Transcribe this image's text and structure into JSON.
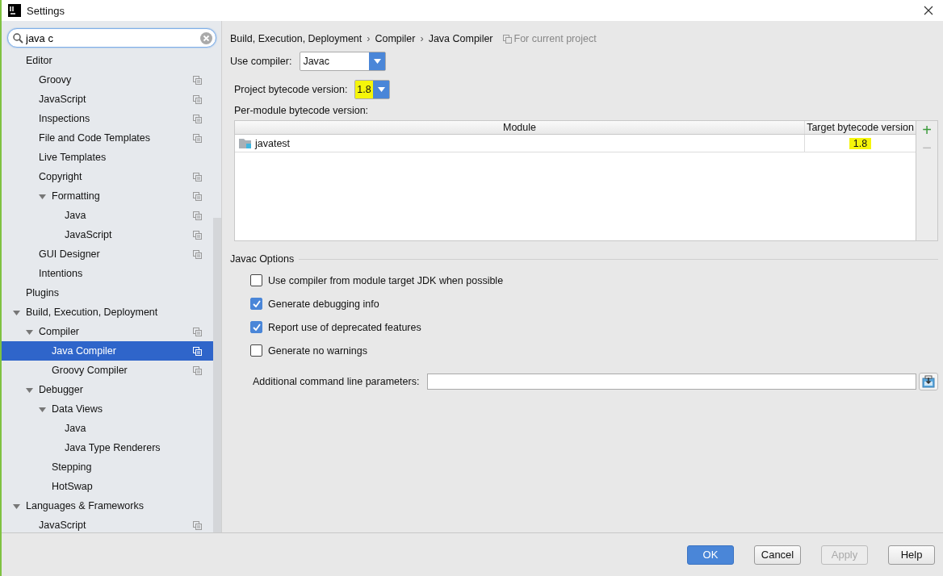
{
  "window": {
    "title": "Settings"
  },
  "search": {
    "value": "java c"
  },
  "tree": [
    {
      "label": "Editor",
      "project": false,
      "selected": false,
      "children": [
        {
          "label": "Groovy",
          "project": true,
          "selected": false
        },
        {
          "label": "JavaScript",
          "project": true,
          "selected": false
        },
        {
          "label": "Inspections",
          "project": true,
          "selected": false
        },
        {
          "label": "File and Code Templates",
          "project": true,
          "selected": false
        },
        {
          "label": "Live Templates",
          "project": false,
          "selected": false
        },
        {
          "label": "Copyright",
          "project": true,
          "selected": false,
          "children": [
            {
              "label": "Formatting",
              "project": true,
              "selected": false,
              "expanded": true,
              "children": [
                {
                  "label": "Java",
                  "project": true,
                  "selected": false
                },
                {
                  "label": "JavaScript",
                  "project": true,
                  "selected": false
                }
              ]
            }
          ]
        },
        {
          "label": "GUI Designer",
          "project": true,
          "selected": false
        },
        {
          "label": "Intentions",
          "project": false,
          "selected": false
        }
      ]
    },
    {
      "label": "Plugins",
      "project": false,
      "selected": false
    },
    {
      "label": "Build, Execution, Deployment",
      "project": false,
      "selected": false,
      "expanded": true,
      "children": [
        {
          "label": "Compiler",
          "project": true,
          "selected": false,
          "expanded": true,
          "children": [
            {
              "label": "Java Compiler",
              "project": true,
              "selected": true
            },
            {
              "label": "Groovy Compiler",
              "project": true,
              "selected": false
            }
          ]
        },
        {
          "label": "Debugger",
          "project": false,
          "selected": false,
          "expanded": true,
          "children": [
            {
              "label": "Data Views",
              "project": false,
              "selected": false,
              "expanded": true,
              "children": [
                {
                  "label": "Java",
                  "project": false,
                  "selected": false
                },
                {
                  "label": "Java Type Renderers",
                  "project": false,
                  "selected": false
                }
              ]
            },
            {
              "label": "Stepping",
              "project": false,
              "selected": false
            },
            {
              "label": "HotSwap",
              "project": false,
              "selected": false
            }
          ]
        }
      ]
    },
    {
      "label": "Languages & Frameworks",
      "project": false,
      "selected": false,
      "expanded": true,
      "children": [
        {
          "label": "JavaScript",
          "project": true,
          "selected": false
        }
      ]
    }
  ],
  "breadcrumb": [
    "Build, Execution, Deployment",
    "Compiler",
    "Java Compiler"
  ],
  "breadcrumb_separator": "›",
  "scope_note": "For current project",
  "use_compiler": {
    "label": "Use compiler:",
    "value": "Javac",
    "search_match": false
  },
  "project_bytecode": {
    "label": "Project bytecode version:",
    "value": "1.8",
    "search_match": true
  },
  "per_module_label": "Per-module bytecode version:",
  "table": {
    "columns": [
      "Module",
      "Target bytecode version"
    ],
    "rows": [
      {
        "module": "javatest",
        "version": "1.8",
        "search_match": true
      }
    ]
  },
  "table_buttons": [
    {
      "symbol": "+",
      "disabled": false
    },
    {
      "symbol": "−",
      "disabled": true
    }
  ],
  "javac_options": {
    "title": "Javac Options",
    "checkboxes": [
      {
        "label": "Use compiler from module target JDK when possible",
        "checked": false
      },
      {
        "label": "Generate debugging info",
        "checked": true
      },
      {
        "label": "Report use of deprecated features",
        "checked": true
      },
      {
        "label": "Generate no warnings",
        "checked": false
      }
    ],
    "params_label": "Additional command line parameters:"
  },
  "buttons": [
    {
      "label": "OK",
      "kind": "primary"
    },
    {
      "label": "Cancel",
      "kind": "default"
    },
    {
      "label": "Apply",
      "kind": "disabled"
    },
    {
      "label": "Help",
      "kind": "default"
    }
  ]
}
